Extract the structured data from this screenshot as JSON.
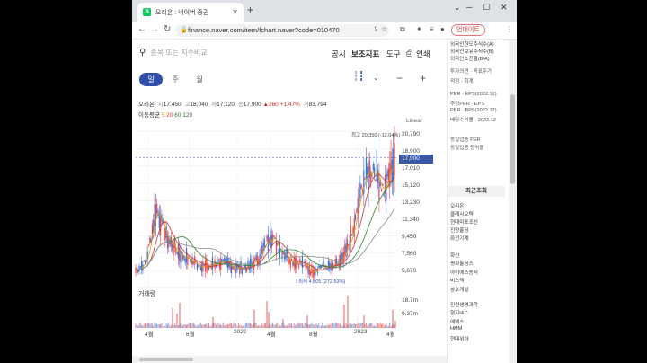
{
  "browser": {
    "tab_title": "오리온 : 네이버 증권",
    "favicon_letter": "N",
    "url": "finance.naver.com/item/fchart.naver?code=010470",
    "update_button": "업데이트"
  },
  "search": {
    "placeholder": "종목 또는 지수비교"
  },
  "menu": [
    "공시",
    "보조지표",
    "도구",
    "인쇄"
  ],
  "periods": [
    "일",
    "주",
    "월"
  ],
  "price": {
    "name": "오리온",
    "open_label": "시",
    "open": "17,450",
    "high_label": "고",
    "high": "18,040",
    "low_label": "저",
    "low": "17,120",
    "close_label": "종",
    "close": "17,900",
    "change": "▲260",
    "pct": "+1.47%",
    "vol_label": "거",
    "volume": "83,794"
  },
  "ma": {
    "label": "이동평균",
    "values": [
      "5",
      "20",
      "60",
      "120"
    ]
  },
  "scale_label": "Linear",
  "price_axis": [
    "20,790",
    "18,900",
    "17,010",
    "15,120",
    "13,230",
    "11,340",
    "9,450",
    "7,560",
    "5,670"
  ],
  "current_price_tag": "17,900",
  "annotations": {
    "high": "최고 20,350 (-12.04%)",
    "low": "최저 4,805 (272.53%)"
  },
  "volume_label": "거래량",
  "volume_axis": [
    "18.7m",
    "9.37m"
  ],
  "x_axis": [
    "4월",
    "8월",
    "2022",
    "4월",
    "8월",
    "2023",
    "4월"
  ],
  "side": {
    "top_lines": [
      "외국인한도주식수(A)",
      "외국인보유주식수(B)",
      "외국인소진율(B/A)"
    ],
    "info_lines": [
      "투자의견 · 목표주가",
      "적정 · 회계",
      "PER · EPS(2022.12)",
      "추정PER · EPS",
      "PBR · BPS(2022.12)",
      "배당수익률 · 2022.12",
      "동일업종 PER",
      "동일업종 등락률"
    ],
    "recent_title": "최근조회",
    "recent": [
      "오리온",
      "클래시오텍",
      "현대미포조선",
      "진양홀딩",
      "화천기계",
      "화신",
      "평화홀딩스",
      "아이에스동서",
      "비스텍",
      "삼호개발",
      "진원생명과학",
      "형지I&C",
      "에넥스",
      "HMM",
      "현대위아"
    ]
  },
  "chart_data": {
    "type": "line",
    "title": "오리온",
    "series": [
      {
        "name": "오리온",
        "x": [
          "2021-03",
          "2021-04",
          "2021-05",
          "2021-06",
          "2021-07",
          "2021-08",
          "2021-09",
          "2021-10",
          "2021-11",
          "2021-12",
          "2022-01",
          "2022-02",
          "2022-03",
          "2022-04",
          "2022-05",
          "2022-06",
          "2022-07",
          "2022-08",
          "2022-09",
          "2022-10",
          "2022-11",
          "2022-12",
          "2023-01",
          "2023-02",
          "2023-03",
          "2023-04"
        ],
        "values": [
          5700,
          6600,
          12500,
          9200,
          7800,
          6900,
          6400,
          6000,
          6600,
          6300,
          5900,
          6100,
          7200,
          9600,
          8000,
          6800,
          6500,
          5600,
          6200,
          6000,
          6800,
          9800,
          15500,
          16900,
          14300,
          17900
        ]
      }
    ],
    "ylim": [
      4805,
      20790
    ],
    "yticks": [
      "20,790",
      "18,900",
      "17,010",
      "15,120",
      "13,230",
      "11,340",
      "9,450",
      "7,560",
      "5,670"
    ],
    "xticks": [
      "4월",
      "8월",
      "2022",
      "4월",
      "8월",
      "2023",
      "4월"
    ],
    "high": 20350,
    "low": 4805,
    "grid": true,
    "volume_ylim": [
      0,
      18700000
    ]
  }
}
